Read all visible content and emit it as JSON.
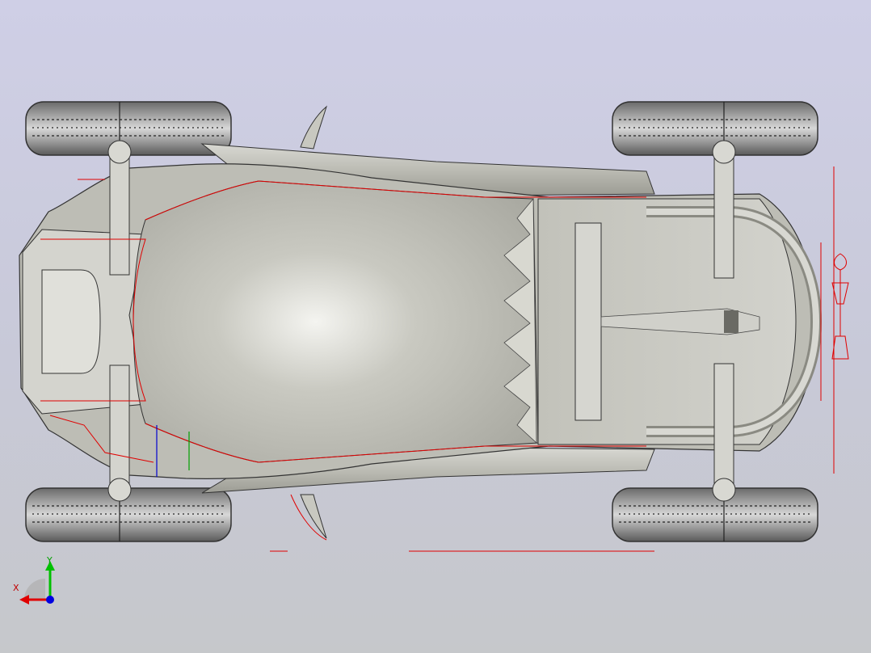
{
  "viewport": {
    "background_top": "#cfcfe6",
    "background_bottom": "#c6c8cb",
    "model": "vehicle-chassis-top-view",
    "sketch_line_color": "#e00000",
    "body_color": "#c4c4bc",
    "tire_color": "#4a4a4a"
  },
  "triad": {
    "x_label": "X",
    "y_label": "Y",
    "x_color": "#e00000",
    "y_color": "#00c000",
    "z_color": "#0000e0"
  }
}
